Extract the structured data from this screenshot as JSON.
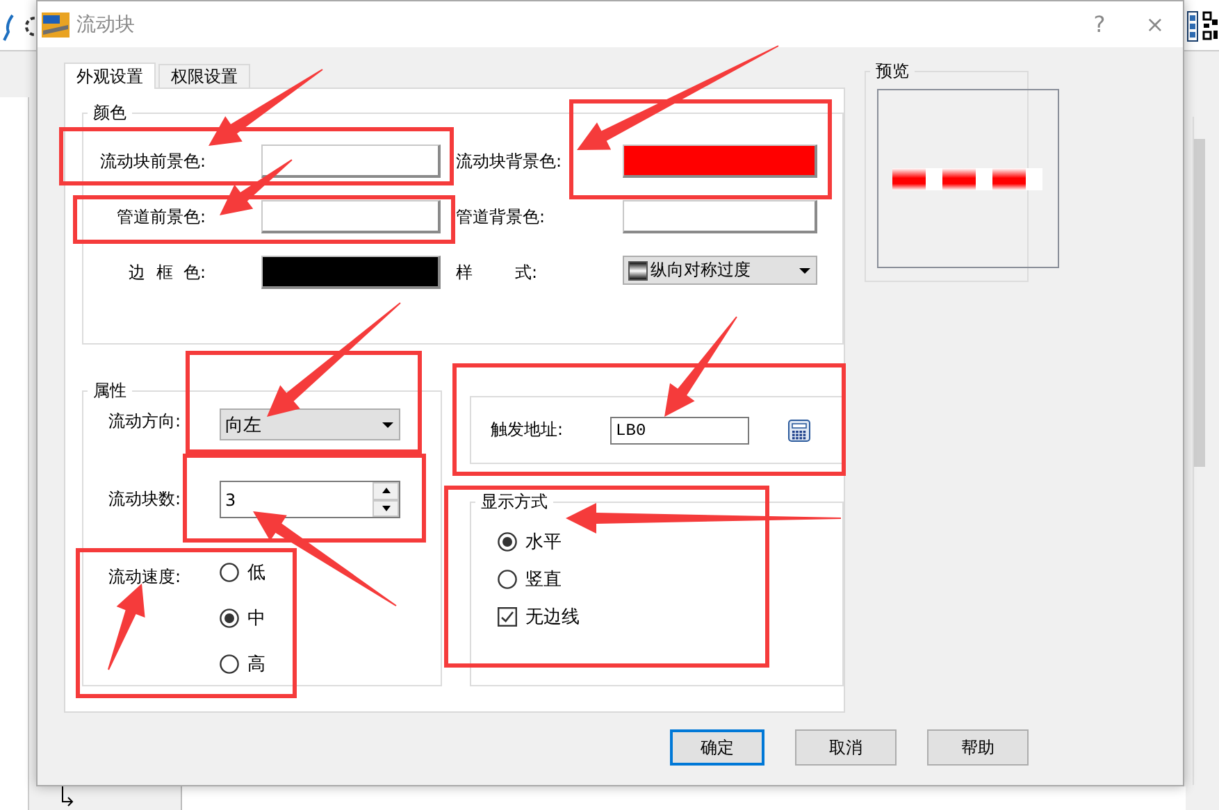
{
  "window": {
    "title": "流动块",
    "help": "?",
    "close": "×"
  },
  "tabs": [
    {
      "label": "外观设置",
      "selected": true
    },
    {
      "label": "权限设置",
      "selected": false
    }
  ],
  "color_group": {
    "title": "颜色",
    "fields": [
      {
        "kind": "swatch",
        "label": "流动块前景色:",
        "color": "#ffffff"
      },
      {
        "kind": "swatch",
        "label": "流动块背景色:",
        "color": "#ff0000"
      },
      {
        "kind": "swatch",
        "label": "管道前景色:",
        "color": "#ffffff"
      },
      {
        "kind": "swatch",
        "label": "管道背景色:",
        "color": "#ffffff"
      },
      {
        "kind": "swatch",
        "label": "边  框  色:",
        "color": "#000000"
      },
      {
        "kind": "dropdown",
        "label": "样        式:",
        "value": "纵向对称过度"
      }
    ]
  },
  "properties": {
    "title": "属性",
    "direction": {
      "label": "流动方向:",
      "value": "向左"
    },
    "count": {
      "label": "流动块数:",
      "value": "3"
    },
    "speed": {
      "label": "流动速度:",
      "options": [
        {
          "label": "低",
          "selected": false
        },
        {
          "label": "中",
          "selected": true
        },
        {
          "label": "高",
          "selected": false
        }
      ]
    }
  },
  "trigger": {
    "label": "触发地址:",
    "value": "LB0"
  },
  "display": {
    "title": "显示方式",
    "options": [
      {
        "label": "水平",
        "selected": true
      },
      {
        "label": "竖直",
        "selected": false
      }
    ],
    "no_border": {
      "label": "无边线",
      "checked": true
    }
  },
  "preview": {
    "title": "预览"
  },
  "buttons": [
    {
      "label": "确定",
      "default": true
    },
    {
      "label": "取消",
      "default": false
    },
    {
      "label": "帮助",
      "default": false
    }
  ]
}
